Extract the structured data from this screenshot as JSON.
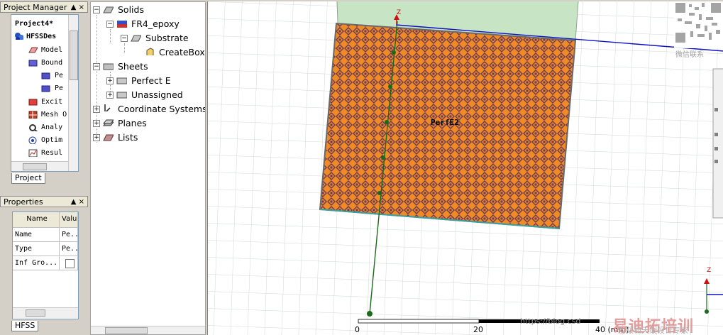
{
  "project_manager": {
    "title": "Project Manager",
    "controls": "▲ ×",
    "items": [
      {
        "label": "Project4*",
        "icon": "project-icon"
      },
      {
        "label": "HFSSDes",
        "icon": "hfss-design-icon"
      },
      {
        "label": "Model",
        "icon": "model-icon"
      },
      {
        "label": "Bound",
        "icon": "boundaries-icon"
      },
      {
        "label": "Pe",
        "icon": "boundary-item-icon"
      },
      {
        "label": "Pe",
        "icon": "boundary-item-icon"
      },
      {
        "label": "Excit",
        "icon": "excitations-icon"
      },
      {
        "label": "Mesh O",
        "icon": "mesh-icon"
      },
      {
        "label": "Analy",
        "icon": "analysis-icon"
      },
      {
        "label": "Optim",
        "icon": "optimetrics-icon"
      },
      {
        "label": "Resul",
        "icon": "results-icon"
      }
    ],
    "tab": "Project"
  },
  "properties": {
    "title": "Properties",
    "controls": "▲ ×",
    "headers": [
      "Name",
      "Valu"
    ],
    "rows": [
      {
        "name": "Name",
        "value": "Pe..."
      },
      {
        "name": "Type",
        "value": "Pe..."
      },
      {
        "name": "Inf Gro...",
        "value": ""
      }
    ],
    "tab": "HFSS"
  },
  "model_tree": {
    "items": [
      {
        "label": "Solids",
        "expander": "−",
        "icon": "solids-icon"
      },
      {
        "label": "FR4_epoxy",
        "expander": "−",
        "icon": "material-icon"
      },
      {
        "label": "Substrate",
        "expander": "−",
        "icon": "solid-object-icon"
      },
      {
        "label": "CreateBox",
        "expander": "",
        "icon": "create-box-icon"
      },
      {
        "label": "Sheets",
        "expander": "−",
        "icon": "sheets-icon"
      },
      {
        "label": "Perfect E",
        "expander": "+",
        "icon": "sheet-group-icon"
      },
      {
        "label": "Unassigned",
        "expander": "+",
        "icon": "sheet-group-icon"
      },
      {
        "label": "Coordinate Systems",
        "expander": "+",
        "icon": "coordinate-systems-icon"
      },
      {
        "label": "Planes",
        "expander": "+",
        "icon": "planes-icon"
      },
      {
        "label": "Lists",
        "expander": "+",
        "icon": "lists-icon"
      }
    ]
  },
  "viewport": {
    "object_label": "PerfE2",
    "axis_z": "Z",
    "axis_z_small": "Z",
    "scale_labels": [
      "0",
      "20",
      "40 (mm)"
    ],
    "watermark_url": "https://blog.csd",
    "watermark_cn_big": "易迪拓培训",
    "watermark_cn_small": "射频和天线设计专家",
    "qr_caption": "微信联系"
  },
  "colors": {
    "patch_fill": "#f08a24",
    "patch_pattern": "#6a3a58",
    "grid": "#d0d6d0",
    "substrate_green": "#c7e4c4",
    "axis_blue": "#1010c0",
    "axis_green": "#1a6a1a",
    "axis_red": "#d01010"
  }
}
